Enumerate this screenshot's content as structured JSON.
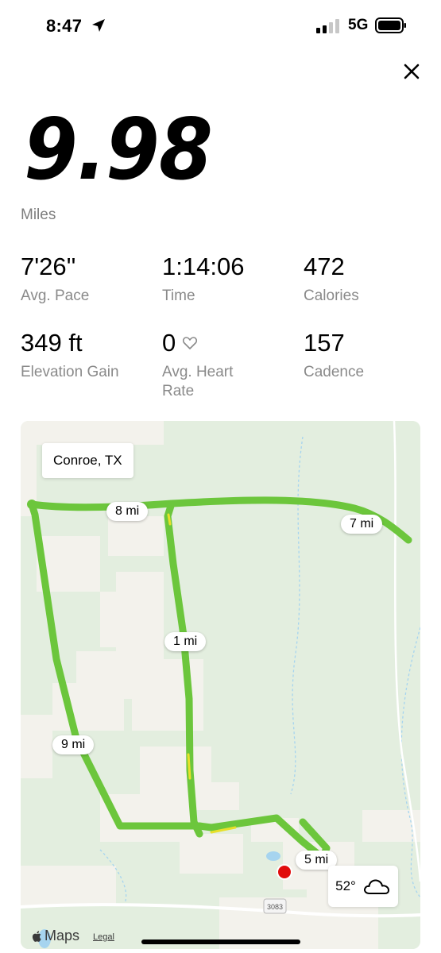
{
  "status_bar": {
    "time": "8:47",
    "network": "5G",
    "icons": [
      "location-arrow-icon",
      "signal-icon",
      "battery-icon"
    ]
  },
  "header": {
    "close_icon": "close-icon"
  },
  "summary": {
    "distance": "9.98",
    "unit": "Miles"
  },
  "stats": [
    {
      "value": "7'26''",
      "label": "Avg. Pace"
    },
    {
      "value": "1:14:06",
      "label": "Time"
    },
    {
      "value": "472",
      "label": "Calories"
    },
    {
      "value": "349 ft",
      "label": "Elevation Gain"
    },
    {
      "value": "0",
      "label": "Avg. Heart Rate",
      "icon": "heart-outline-icon"
    },
    {
      "value": "157",
      "label": "Cadence"
    }
  ],
  "map": {
    "location": "Conroe, TX",
    "mile_markers": [
      "8 mi",
      "7 mi",
      "1 mi",
      "9 mi",
      "5 mi"
    ],
    "road_shield": "3083",
    "weather": {
      "temp": "52°",
      "icon": "cloud-icon"
    },
    "attribution": {
      "logo": "Maps",
      "legal": "Legal"
    },
    "colors": {
      "route": "#6cc63c",
      "route_slow": "#e8e02a",
      "end_marker": "#e10d0d",
      "land": "#e3eedf",
      "buildings": "#f3f2ec",
      "water": "#a6d4ef"
    }
  }
}
